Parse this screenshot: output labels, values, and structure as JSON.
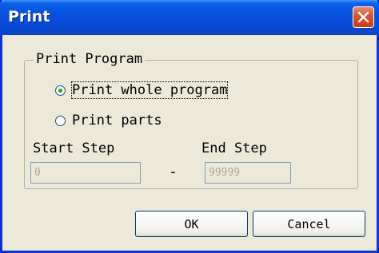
{
  "window": {
    "title": "Print",
    "close_icon": "close-x-icon"
  },
  "print_program_group": {
    "legend": "Print Program",
    "options": [
      {
        "label": "Print whole program",
        "checked": true
      },
      {
        "label": "Print parts",
        "checked": false
      }
    ]
  },
  "steps": {
    "start_label": "Start Step",
    "end_label": "End Step",
    "start_value": "0",
    "end_value": "99999",
    "separator": "-"
  },
  "buttons": {
    "ok": "OK",
    "cancel": "Cancel"
  },
  "colors": {
    "titlebar": "#0551e0",
    "close_button": "#d8552d",
    "dialog_bg": "#ece9d8"
  }
}
